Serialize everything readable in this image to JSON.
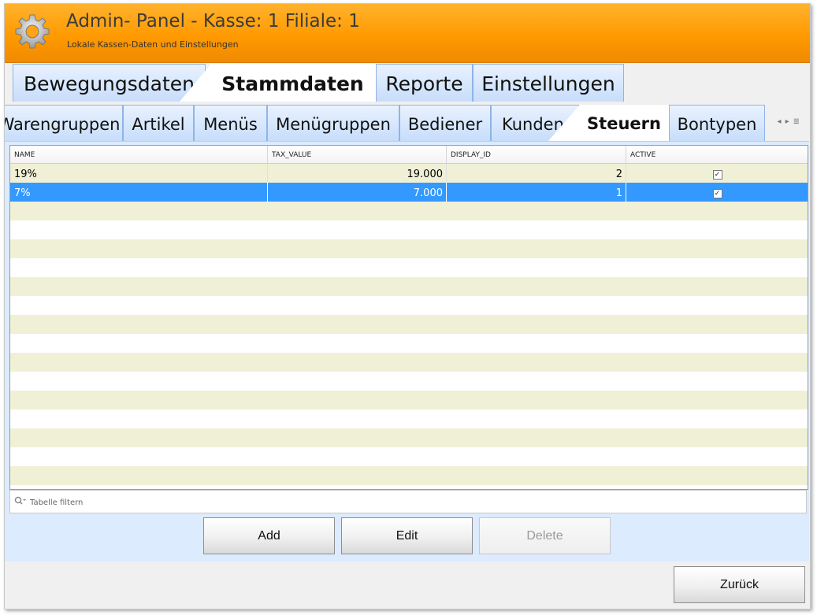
{
  "header": {
    "title": "Admin- Panel - Kasse: 1 Filiale: 1",
    "subtitle": "Lokale Kassen-Daten und Einstellungen",
    "icon": "gear-icon"
  },
  "main_tabs": [
    {
      "label": "Bewegungsdaten",
      "active": false
    },
    {
      "label": "Stammdaten",
      "active": true
    },
    {
      "label": "Reporte",
      "active": false
    },
    {
      "label": "Einstellungen",
      "active": false
    }
  ],
  "sub_tabs": [
    {
      "label": "Warengruppen",
      "active": false
    },
    {
      "label": "Artikel",
      "active": false
    },
    {
      "label": "Menüs",
      "active": false
    },
    {
      "label": "Menügruppen",
      "active": false
    },
    {
      "label": "Bediener",
      "active": false
    },
    {
      "label": "Kunden",
      "active": false
    },
    {
      "label": "Steuern",
      "active": true
    },
    {
      "label": "Bontypen",
      "active": false
    }
  ],
  "table": {
    "columns": [
      "NAME",
      "TAX_VALUE",
      "DISPLAY_ID",
      "ACTIVE"
    ],
    "rows": [
      {
        "name": "19%",
        "tax_value": "19.000",
        "display_id": "2",
        "active": true,
        "selected": false
      },
      {
        "name": "7%",
        "tax_value": "7.000",
        "display_id": "1",
        "active": true,
        "selected": true
      }
    ],
    "empty_rows": 15
  },
  "filter": {
    "placeholder": "Tabelle filtern"
  },
  "actions": {
    "add": "Add",
    "edit": "Edit",
    "delete": "Delete",
    "delete_enabled": false
  },
  "footer": {
    "back": "Zurück"
  },
  "colors": {
    "header_orange": "#ff9a00",
    "selection_blue": "#3399ff",
    "stripe": "#f0f0d6"
  }
}
